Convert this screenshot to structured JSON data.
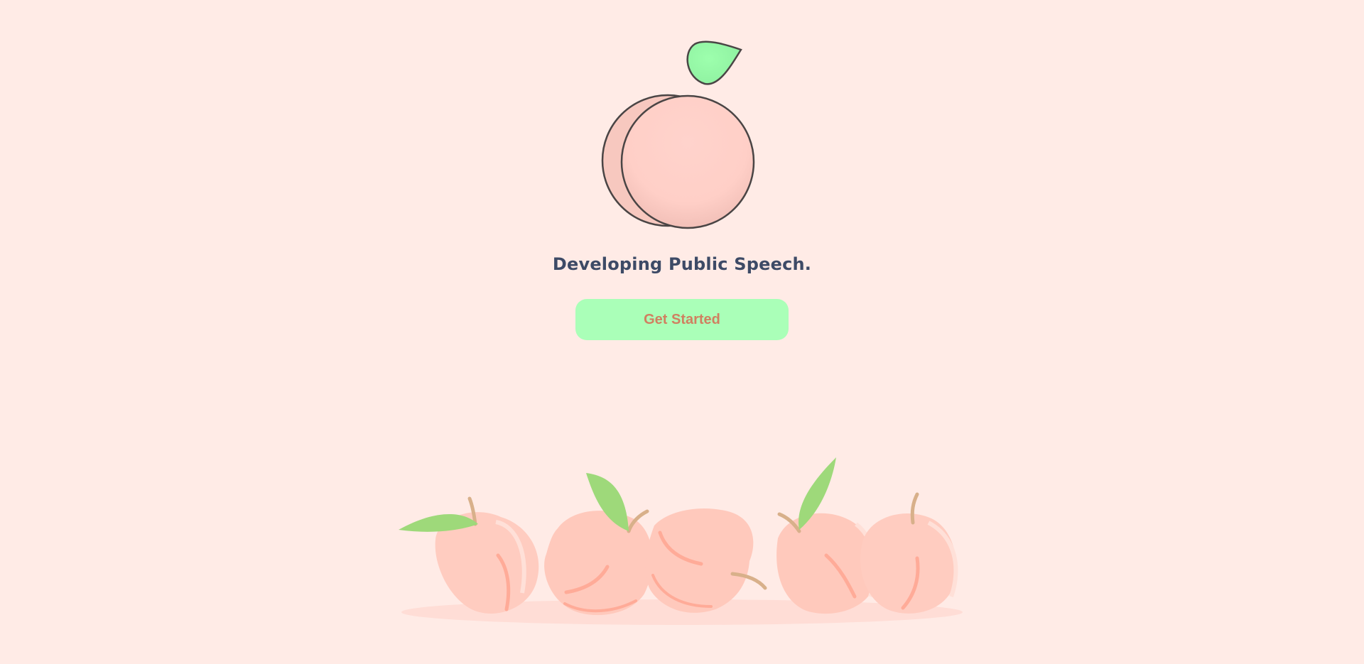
{
  "hero": {
    "tagline": "Developing Public Speech.",
    "cta_label": "Get Started"
  },
  "colors": {
    "background": "#ffebe6",
    "tagline": "#3d4a66",
    "cta_background": "#aaffb8",
    "cta_text": "#d08060",
    "peach": "#ffccc0",
    "leaf": "#9ed97a",
    "logo_leaf": "#99ffaa"
  },
  "icons": {
    "logo": "peach-logo-icon",
    "decoration": "peaches-illustration"
  }
}
